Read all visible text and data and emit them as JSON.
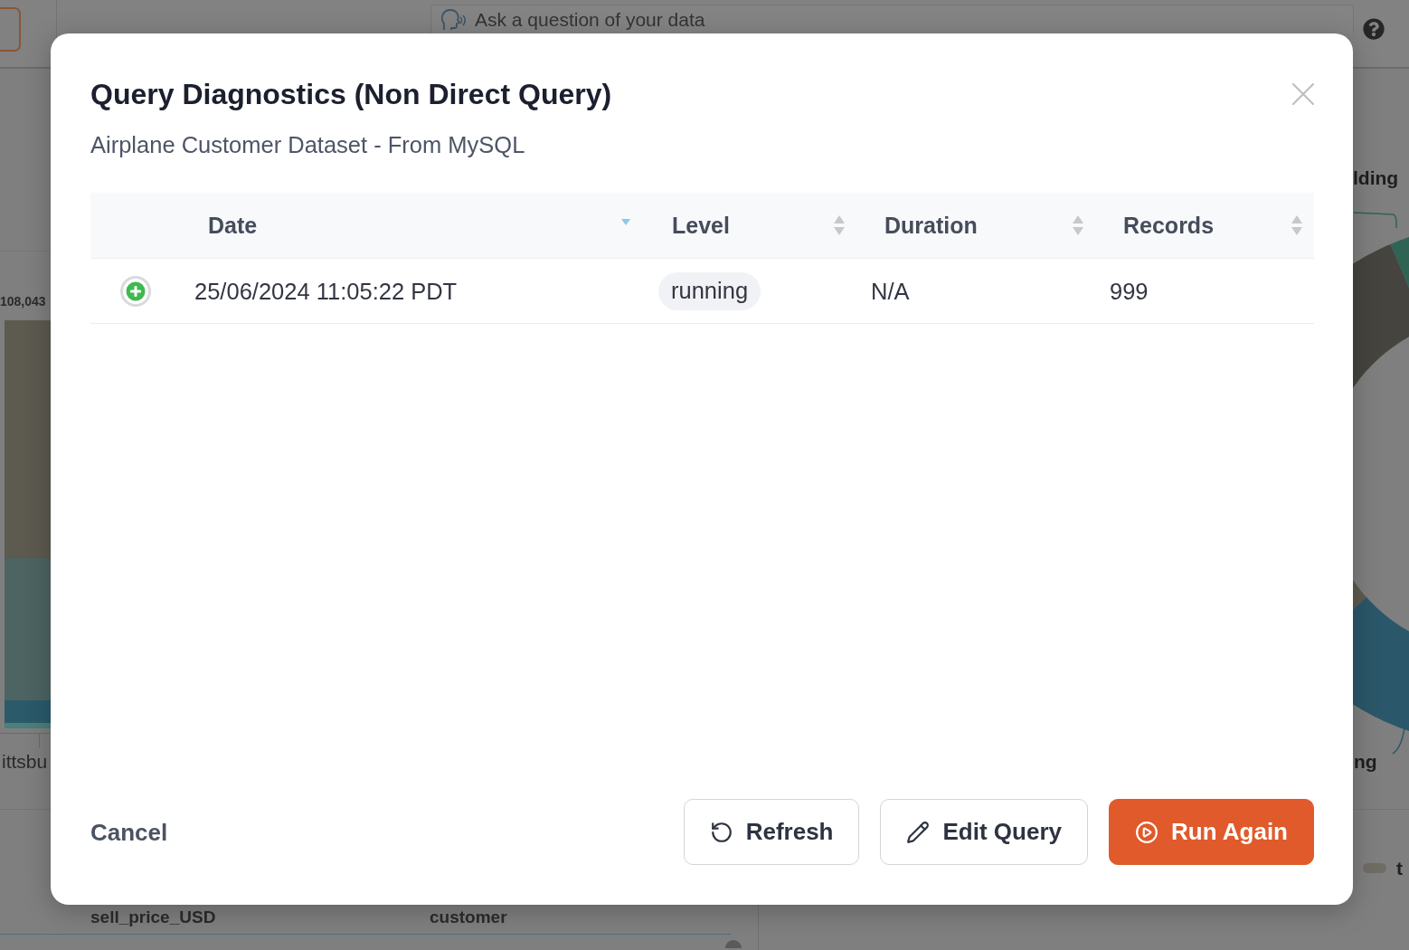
{
  "background": {
    "search": {
      "placeholder": "Ask a question of your data"
    },
    "bar_chart": {
      "value_label": "108,043",
      "category_label": "ittsbu"
    },
    "donut_chart": {
      "labels": [
        "lding",
        "ng"
      ]
    },
    "table": {
      "columns": [
        "sell_price_USD",
        "customer"
      ]
    },
    "legend": {
      "label": "t"
    }
  },
  "dialog": {
    "title": "Query Diagnostics (Non Direct Query)",
    "subtitle": "Airplane Customer Dataset - From MySQL",
    "table": {
      "columns": [
        {
          "label": "Date",
          "sorted": true
        },
        {
          "label": "Level",
          "sorted": false
        },
        {
          "label": "Duration",
          "sorted": false
        },
        {
          "label": "Records",
          "sorted": false
        }
      ],
      "rows": [
        {
          "expanded": false,
          "date": "25/06/2024 11:05:22 PDT",
          "level": "running",
          "duration": "N/A",
          "records": "999"
        }
      ]
    },
    "cancel": "Cancel",
    "buttons": [
      {
        "label": "Refresh",
        "kind": "default"
      },
      {
        "label": "Edit Query",
        "kind": "default"
      },
      {
        "label": "Run Again",
        "kind": "primary"
      }
    ]
  }
}
